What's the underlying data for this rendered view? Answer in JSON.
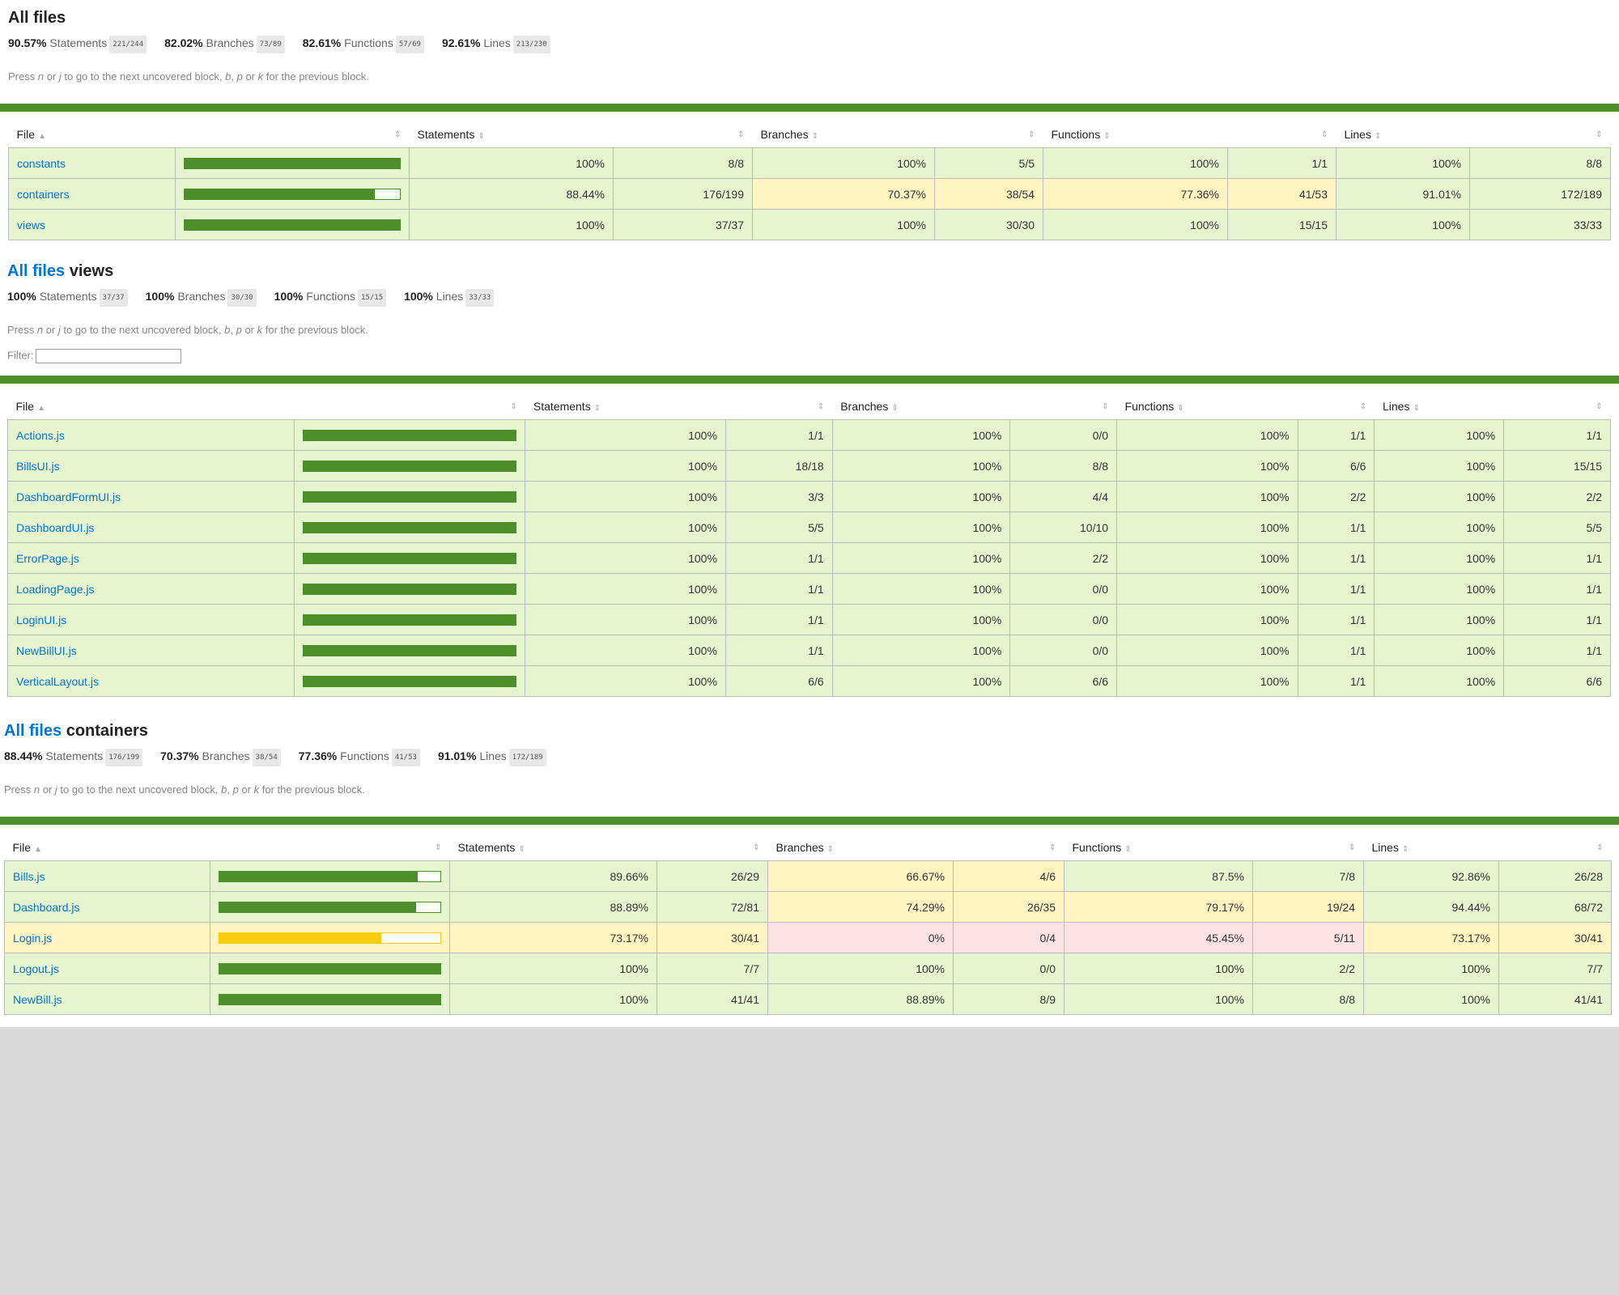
{
  "hint": {
    "press": "Press ",
    "n": "n",
    "or1": " or ",
    "j": "j",
    "next": " to go to the next uncovered block, ",
    "b": "b",
    "comma": ", ",
    "p": "p",
    "or2": " or ",
    "k": "k",
    "prev": " for the previous block."
  },
  "headers": {
    "file": "File",
    "statements": "Statements",
    "branches": "Branches",
    "functions": "Functions",
    "lines": "Lines",
    "sort_asc": "▲",
    "sort": "⇕"
  },
  "filter_label": "Filter:",
  "sections": [
    {
      "title_link": "",
      "title": "All files",
      "summary": [
        {
          "pct": "90.57%",
          "label": "Statements",
          "frac": "221/244"
        },
        {
          "pct": "82.02%",
          "label": "Branches",
          "frac": "73/89"
        },
        {
          "pct": "82.61%",
          "label": "Functions",
          "frac": "57/69"
        },
        {
          "pct": "92.61%",
          "label": "Lines",
          "frac": "213/230"
        }
      ],
      "rows": [
        {
          "file": "constants",
          "level": "high",
          "cov": 1.0,
          "s_pct": "100%",
          "s_frac": "8/8",
          "b_pct": "100%",
          "b_frac": "5/5",
          "f_pct": "100%",
          "f_frac": "1/1",
          "l_pct": "100%",
          "l_frac": "8/8",
          "s_lvl": "high",
          "b_lvl": "high",
          "f_lvl": "high",
          "l_lvl": "high"
        },
        {
          "file": "containers",
          "level": "high",
          "cov": 0.8844,
          "s_pct": "88.44%",
          "s_frac": "176/199",
          "b_pct": "70.37%",
          "b_frac": "38/54",
          "f_pct": "77.36%",
          "f_frac": "41/53",
          "l_pct": "91.01%",
          "l_frac": "172/189",
          "s_lvl": "high",
          "b_lvl": "medium",
          "f_lvl": "medium",
          "l_lvl": "high"
        },
        {
          "file": "views",
          "level": "high",
          "cov": 1.0,
          "s_pct": "100%",
          "s_frac": "37/37",
          "b_pct": "100%",
          "b_frac": "30/30",
          "f_pct": "100%",
          "f_frac": "15/15",
          "l_pct": "100%",
          "l_frac": "33/33",
          "s_lvl": "high",
          "b_lvl": "high",
          "f_lvl": "high",
          "l_lvl": "high"
        }
      ]
    },
    {
      "title_link": "All files",
      "title": "views",
      "summary": [
        {
          "pct": "100%",
          "label": "Statements",
          "frac": "37/37"
        },
        {
          "pct": "100%",
          "label": "Branches",
          "frac": "30/30"
        },
        {
          "pct": "100%",
          "label": "Functions",
          "frac": "15/15"
        },
        {
          "pct": "100%",
          "label": "Lines",
          "frac": "33/33"
        }
      ],
      "rows": [
        {
          "file": "Actions.js",
          "level": "high",
          "cov": 1.0,
          "s_pct": "100%",
          "s_frac": "1/1",
          "b_pct": "100%",
          "b_frac": "0/0",
          "f_pct": "100%",
          "f_frac": "1/1",
          "l_pct": "100%",
          "l_frac": "1/1",
          "s_lvl": "high",
          "b_lvl": "high",
          "f_lvl": "high",
          "l_lvl": "high"
        },
        {
          "file": "BillsUI.js",
          "level": "high",
          "cov": 1.0,
          "s_pct": "100%",
          "s_frac": "18/18",
          "b_pct": "100%",
          "b_frac": "8/8",
          "f_pct": "100%",
          "f_frac": "6/6",
          "l_pct": "100%",
          "l_frac": "15/15",
          "s_lvl": "high",
          "b_lvl": "high",
          "f_lvl": "high",
          "l_lvl": "high"
        },
        {
          "file": "DashboardFormUI.js",
          "level": "high",
          "cov": 1.0,
          "s_pct": "100%",
          "s_frac": "3/3",
          "b_pct": "100%",
          "b_frac": "4/4",
          "f_pct": "100%",
          "f_frac": "2/2",
          "l_pct": "100%",
          "l_frac": "2/2",
          "s_lvl": "high",
          "b_lvl": "high",
          "f_lvl": "high",
          "l_lvl": "high"
        },
        {
          "file": "DashboardUI.js",
          "level": "high",
          "cov": 1.0,
          "s_pct": "100%",
          "s_frac": "5/5",
          "b_pct": "100%",
          "b_frac": "10/10",
          "f_pct": "100%",
          "f_frac": "1/1",
          "l_pct": "100%",
          "l_frac": "5/5",
          "s_lvl": "high",
          "b_lvl": "high",
          "f_lvl": "high",
          "l_lvl": "high"
        },
        {
          "file": "ErrorPage.js",
          "level": "high",
          "cov": 1.0,
          "s_pct": "100%",
          "s_frac": "1/1",
          "b_pct": "100%",
          "b_frac": "2/2",
          "f_pct": "100%",
          "f_frac": "1/1",
          "l_pct": "100%",
          "l_frac": "1/1",
          "s_lvl": "high",
          "b_lvl": "high",
          "f_lvl": "high",
          "l_lvl": "high"
        },
        {
          "file": "LoadingPage.js",
          "level": "high",
          "cov": 1.0,
          "s_pct": "100%",
          "s_frac": "1/1",
          "b_pct": "100%",
          "b_frac": "0/0",
          "f_pct": "100%",
          "f_frac": "1/1",
          "l_pct": "100%",
          "l_frac": "1/1",
          "s_lvl": "high",
          "b_lvl": "high",
          "f_lvl": "high",
          "l_lvl": "high"
        },
        {
          "file": "LoginUI.js",
          "level": "high",
          "cov": 1.0,
          "s_pct": "100%",
          "s_frac": "1/1",
          "b_pct": "100%",
          "b_frac": "0/0",
          "f_pct": "100%",
          "f_frac": "1/1",
          "l_pct": "100%",
          "l_frac": "1/1",
          "s_lvl": "high",
          "b_lvl": "high",
          "f_lvl": "high",
          "l_lvl": "high"
        },
        {
          "file": "NewBillUI.js",
          "level": "high",
          "cov": 1.0,
          "s_pct": "100%",
          "s_frac": "1/1",
          "b_pct": "100%",
          "b_frac": "0/0",
          "f_pct": "100%",
          "f_frac": "1/1",
          "l_pct": "100%",
          "l_frac": "1/1",
          "s_lvl": "high",
          "b_lvl": "high",
          "f_lvl": "high",
          "l_lvl": "high"
        },
        {
          "file": "VerticalLayout.js",
          "level": "high",
          "cov": 1.0,
          "s_pct": "100%",
          "s_frac": "6/6",
          "b_pct": "100%",
          "b_frac": "6/6",
          "f_pct": "100%",
          "f_frac": "1/1",
          "l_pct": "100%",
          "l_frac": "6/6",
          "s_lvl": "high",
          "b_lvl": "high",
          "f_lvl": "high",
          "l_lvl": "high"
        }
      ]
    },
    {
      "title_link": "All files",
      "title": "containers",
      "summary": [
        {
          "pct": "88.44%",
          "label": "Statements",
          "frac": "176/199"
        },
        {
          "pct": "70.37%",
          "label": "Branches",
          "frac": "38/54"
        },
        {
          "pct": "77.36%",
          "label": "Functions",
          "frac": "41/53"
        },
        {
          "pct": "91.01%",
          "label": "Lines",
          "frac": "172/189"
        }
      ],
      "rows": [
        {
          "file": "Bills.js",
          "level": "high",
          "cov": 0.8966,
          "s_pct": "89.66%",
          "s_frac": "26/29",
          "b_pct": "66.67%",
          "b_frac": "4/6",
          "f_pct": "87.5%",
          "f_frac": "7/8",
          "l_pct": "92.86%",
          "l_frac": "26/28",
          "s_lvl": "high",
          "b_lvl": "medium",
          "f_lvl": "high",
          "l_lvl": "high"
        },
        {
          "file": "Dashboard.js",
          "level": "high",
          "cov": 0.8889,
          "s_pct": "88.89%",
          "s_frac": "72/81",
          "b_pct": "74.29%",
          "b_frac": "26/35",
          "f_pct": "79.17%",
          "f_frac": "19/24",
          "l_pct": "94.44%",
          "l_frac": "68/72",
          "s_lvl": "high",
          "b_lvl": "medium",
          "f_lvl": "medium",
          "l_lvl": "high"
        },
        {
          "file": "Login.js",
          "level": "medium",
          "cov": 0.7317,
          "s_pct": "73.17%",
          "s_frac": "30/41",
          "b_pct": "0%",
          "b_frac": "0/4",
          "f_pct": "45.45%",
          "f_frac": "5/11",
          "l_pct": "73.17%",
          "l_frac": "30/41",
          "s_lvl": "medium",
          "b_lvl": "low",
          "f_lvl": "low",
          "l_lvl": "medium"
        },
        {
          "file": "Logout.js",
          "level": "high",
          "cov": 1.0,
          "s_pct": "100%",
          "s_frac": "7/7",
          "b_pct": "100%",
          "b_frac": "0/0",
          "f_pct": "100%",
          "f_frac": "2/2",
          "l_pct": "100%",
          "l_frac": "7/7",
          "s_lvl": "high",
          "b_lvl": "high",
          "f_lvl": "high",
          "l_lvl": "high"
        },
        {
          "file": "NewBill.js",
          "level": "high",
          "cov": 1.0,
          "s_pct": "100%",
          "s_frac": "41/41",
          "b_pct": "88.89%",
          "b_frac": "8/9",
          "f_pct": "100%",
          "f_frac": "8/8",
          "l_pct": "100%",
          "l_frac": "41/41",
          "s_lvl": "high",
          "b_lvl": "high",
          "f_lvl": "high",
          "l_lvl": "high"
        }
      ]
    }
  ]
}
